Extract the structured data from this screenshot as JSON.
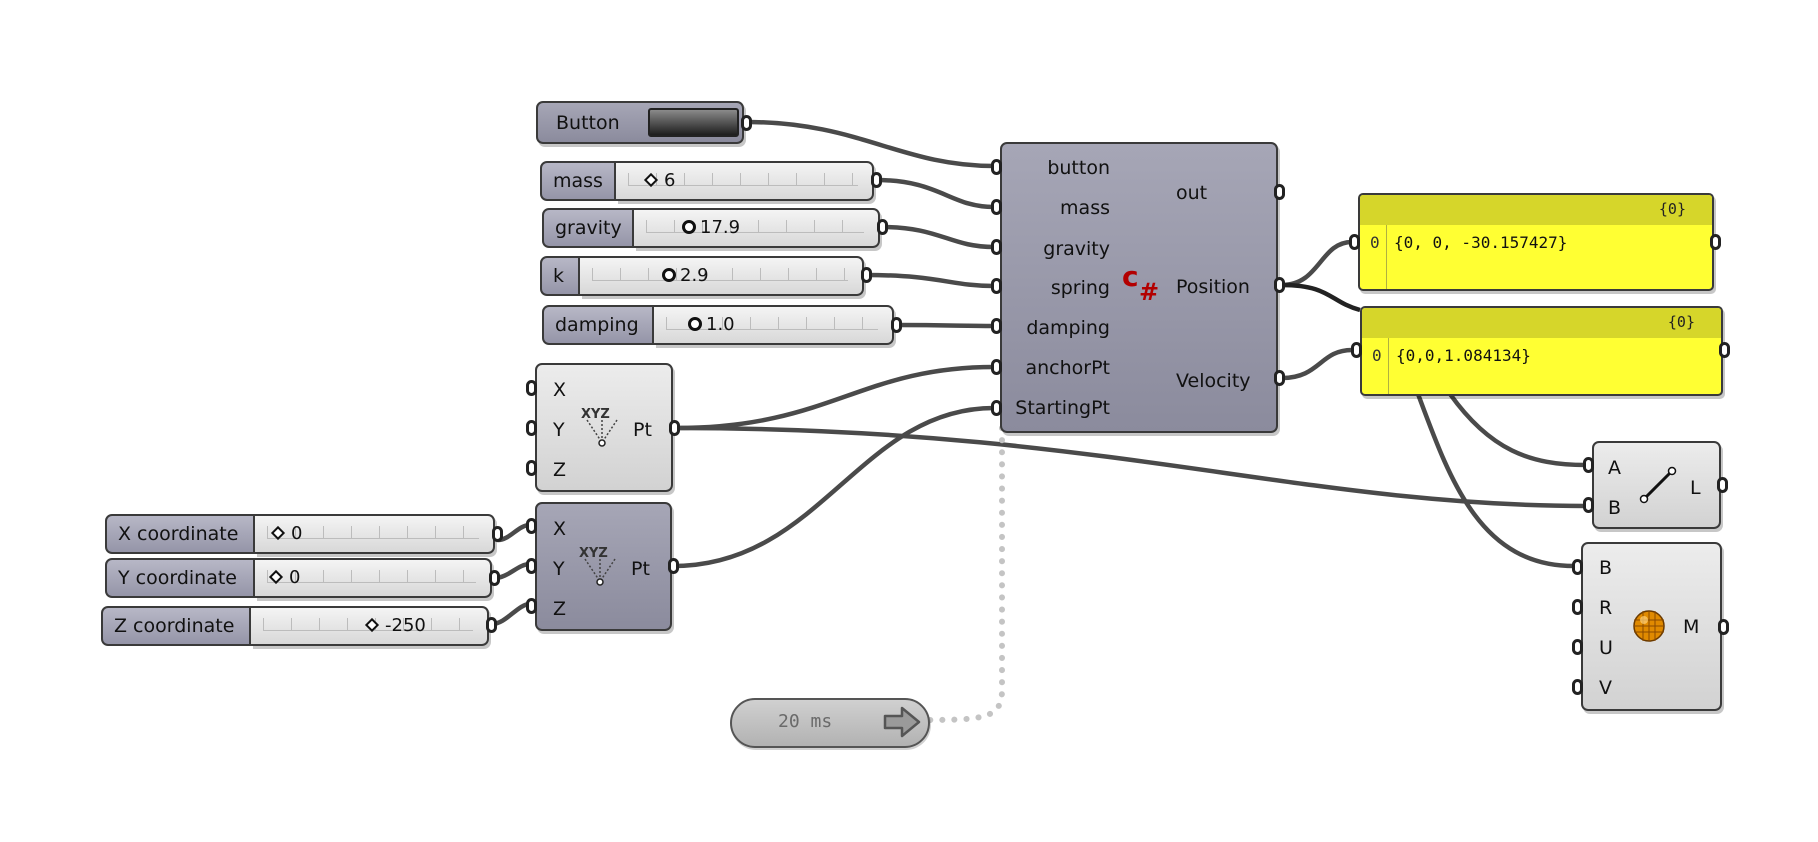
{
  "button_component": {
    "label": "Button"
  },
  "sliders": [
    {
      "id": "mass",
      "label": "mass",
      "value": "6",
      "grip": "diamond"
    },
    {
      "id": "gravity",
      "label": "gravity",
      "value": "17.9",
      "grip": "circle"
    },
    {
      "id": "k",
      "label": "k",
      "value": "2.9",
      "grip": "circle"
    },
    {
      "id": "damping",
      "label": "damping",
      "value": "1.0",
      "grip": "circle"
    },
    {
      "id": "x-coordinate",
      "label": "X coordinate",
      "value": "0",
      "grip": "diamond"
    },
    {
      "id": "y-coordinate",
      "label": "Y coordinate",
      "value": "0",
      "grip": "diamond"
    },
    {
      "id": "z-coordinate",
      "label": "Z coordinate",
      "value": "-250",
      "grip": "diamond"
    }
  ],
  "point_components": [
    {
      "inputs": [
        "X",
        "Y",
        "Z"
      ],
      "output": "Pt",
      "icon": "xyz-point-icon"
    },
    {
      "inputs": [
        "X",
        "Y",
        "Z"
      ],
      "output": "Pt",
      "icon": "xyz-point-icon"
    }
  ],
  "script_component": {
    "inputs": [
      "button",
      "mass",
      "gravity",
      "spring",
      "damping",
      "anchorPt",
      "StartingPt"
    ],
    "outputs": [
      "out",
      "Position",
      "Velocity"
    ],
    "icon": "csharp-icon",
    "icon_color": "#b30000"
  },
  "panels": [
    {
      "count": "{0}",
      "index": "0",
      "text": "{0, 0, -30.157427}"
    },
    {
      "count": "{0}",
      "index": "0",
      "text": "{0,0,1.084134}"
    }
  ],
  "line_component": {
    "inputs": [
      "A",
      "B"
    ],
    "output": "L",
    "icon": "line-icon"
  },
  "sphere_component": {
    "inputs": [
      "B",
      "R",
      "U",
      "V"
    ],
    "output": "M",
    "icon": "mesh-sphere-icon",
    "icon_color": "#e08a00"
  },
  "timer": {
    "label": "20 ms",
    "icon": "arrow-right-icon"
  },
  "colors": {
    "panel_bg": "#ffff33",
    "panel_header": "#d6d62a",
    "wire": "#4a4a4a",
    "component_dark": "#9a9aac"
  }
}
